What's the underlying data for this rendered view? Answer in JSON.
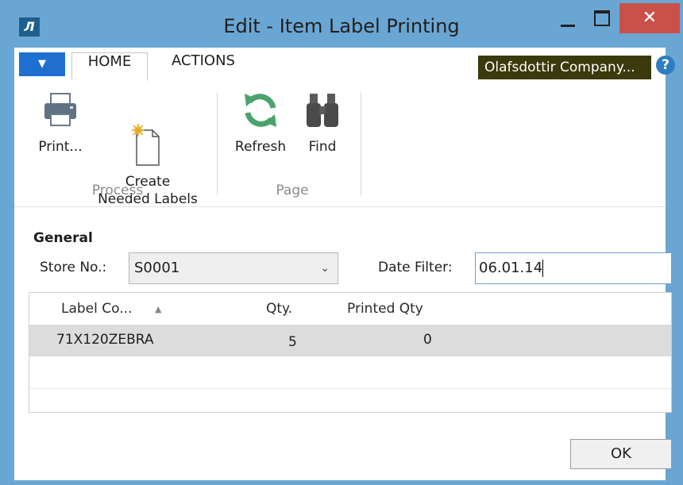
{
  "window": {
    "title": "Edit - Item Label Printing",
    "logo_text": "Л",
    "close_glyph": "✕"
  },
  "ribbon_tabs": {
    "menu_glyph": "▼",
    "tabs": [
      {
        "label": "HOME"
      },
      {
        "label": "ACTIONS"
      }
    ],
    "company": "Olafsdottir Company...",
    "help_glyph": "?"
  },
  "ribbon": {
    "buttons": [
      {
        "label": "Print...",
        "icon": "printer-icon"
      },
      {
        "label": "Create\nNeeded Labels",
        "icon": "new-document-icon"
      },
      {
        "label": "Refresh",
        "icon": "refresh-icon"
      },
      {
        "label": "Find",
        "icon": "binoculars-icon"
      }
    ],
    "groups": [
      {
        "label": "Process"
      },
      {
        "label": "Page"
      }
    ]
  },
  "general": {
    "title": "General",
    "store_label": "Store No.:",
    "store_value": "S0001",
    "date_filter_label": "Date Filter:",
    "date_filter_value": "06.01.14"
  },
  "grid": {
    "columns": [
      "Label Co...",
      "Qty.",
      "Printed Qty"
    ],
    "rows": [
      {
        "label_code": "71X120ZEBRA",
        "qty": "5",
        "printed_qty": "0"
      }
    ]
  },
  "footer": {
    "ok_label": "OK"
  },
  "colors": {
    "titlebar": "#6aa6d3",
    "close": "#c9514a",
    "menu": "#1e6fd0",
    "company_bg": "#3b3a0c",
    "selected_row": "#dcdcdc"
  }
}
